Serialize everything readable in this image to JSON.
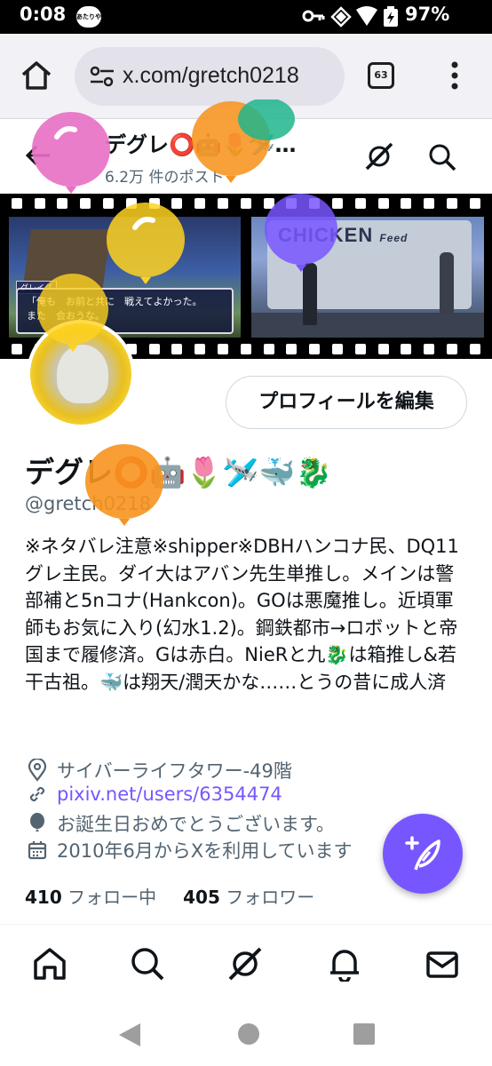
{
  "status_bar": {
    "time": "0:08",
    "app_badge": "あたりや",
    "battery": "97%",
    "icons": [
      "key-icon",
      "wifi-icon",
      "signal-icon",
      "battery-charging-icon"
    ]
  },
  "browser": {
    "url": "x.com/gretch0218",
    "tab_count": "63"
  },
  "header": {
    "name": "デグレ⭕🤖🌷🛩️…",
    "post_count": "6.2万 件のポスト"
  },
  "banner": {
    "dialog_speaker": "グレイグ",
    "dialog_text_1": "「俺も　お前と共に　戦えてよかった。",
    "dialog_text_2": "また　会おうな。",
    "sign_text": "CHICKEN",
    "sign_small": "Feed"
  },
  "profile": {
    "edit_button": "プロフィールを編集",
    "display_name": "デグレ⭕🤖🌷🛩️🐳🐉",
    "handle": "@gretch0218",
    "bio": "※ネタバレ注意※shipper※DBHハンコナ民、DQ11グレ主民。ダイ大はアバン先生単推し。メインは警部補と5nコナ(Hankcon)。GOは悪魔推し。近頃軍師もお気に入り(幻水1.2)。鋼鉄都市→ロボットと帝国まで履修済。Gは赤白。NieRと九🐉は箱推し&若干古祖。🐳は翔天/潤天かな……とうの昔に成人済",
    "location": "サイバーライフタワー-49階",
    "link": "pixiv.net/users/6354474",
    "birthday": "お誕生日おめでとうございます。",
    "joined": "2010年6月からXを利用しています",
    "following_count": "410",
    "following_label": "フォロー中",
    "followers_count": "405",
    "followers_label": "フォロワー"
  },
  "tabs": [
    "home-icon",
    "search-icon",
    "grok-icon",
    "notifications-icon",
    "messages-icon"
  ],
  "colors": {
    "accent": "#7856ff",
    "text": "#0f1419",
    "secondary": "#536471"
  }
}
